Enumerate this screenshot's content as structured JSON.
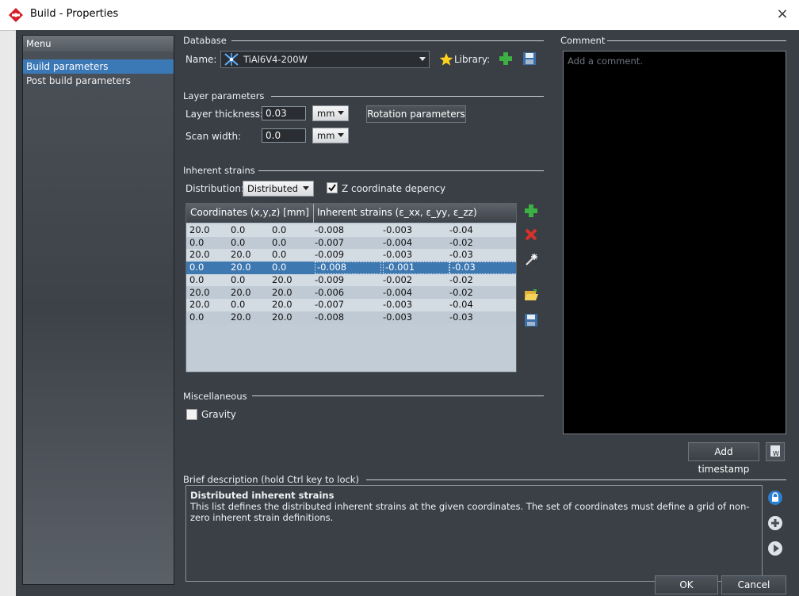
{
  "window": {
    "title": "Build - Properties",
    "close": "×"
  },
  "menu": {
    "header": "Menu",
    "items": [
      {
        "label": "Build parameters",
        "selected": true
      },
      {
        "label": "Post build parameters",
        "selected": false
      }
    ]
  },
  "database": {
    "section": "Database",
    "name_label": "Name:",
    "name_value": "TiAl6V4-200W",
    "library_label": "Library:"
  },
  "layer": {
    "section": "Layer parameters",
    "thickness_label": "Layer thickness:",
    "thickness_value": "0.03",
    "thickness_unit": "mm",
    "scan_label": "Scan width:",
    "scan_value": "0.0",
    "scan_unit": "mm",
    "rotation_button": "Rotation parameters"
  },
  "strains": {
    "section": "Inherent strains",
    "distribution_label": "Distribution:",
    "distribution_value": "Distributed",
    "z_checkbox_label": "Z coordinate depency",
    "z_checked": true,
    "col_coords": "Coordinates (x,y,z) [mm]",
    "col_strains": "Inherent strains (ε_xx, ε_yy, ε_zz)",
    "rows": [
      [
        "20.0",
        "0.0",
        "0.0",
        "-0.008",
        "-0.003",
        "-0.04"
      ],
      [
        "0.0",
        "0.0",
        "0.0",
        "-0.007",
        "-0.004",
        "-0.02"
      ],
      [
        "20.0",
        "20.0",
        "0.0",
        "-0.009",
        "-0.003",
        "-0.03"
      ],
      [
        "0.0",
        "20.0",
        "0.0",
        "-0.008",
        "-0.001",
        "-0.03"
      ],
      [
        "0.0",
        "0.0",
        "20.0",
        "-0.009",
        "-0.002",
        "-0.02"
      ],
      [
        "20.0",
        "20.0",
        "20.0",
        "-0.006",
        "-0.004",
        "-0.02"
      ],
      [
        "20.0",
        "0.0",
        "20.0",
        "-0.007",
        "-0.003",
        "-0.04"
      ],
      [
        "0.0",
        "20.0",
        "20.0",
        "-0.008",
        "-0.003",
        "-0.03"
      ]
    ],
    "selected_row": 3
  },
  "misc": {
    "section": "Miscellaneous",
    "gravity_label": "Gravity",
    "gravity_checked": false
  },
  "comment": {
    "section": "Comment",
    "placeholder": "Add a comment.",
    "timestamp_button": "Add timestamp"
  },
  "description": {
    "section": "Brief description (hold Ctrl key to lock)",
    "title": "Distributed inherent strains",
    "body": "This list defines the distributed inherent strains at the given coordinates. The set of coordinates must define a grid of non-zero inherent strain definitions."
  },
  "footer": {
    "ok": "OK",
    "cancel": "Cancel"
  },
  "colors": {
    "accent": "#3b78b6",
    "add_green": "#3cb043",
    "delete_red": "#d8322a",
    "brand_red": "#d4202a"
  },
  "icons": {
    "app": "build-logo-icon",
    "material": "material-crystal-icon",
    "star": "star-icon",
    "add": "plus-icon",
    "delete": "x-icon",
    "wand": "magic-wand-icon",
    "open": "folder-open-icon",
    "save": "floppy-icon"
  }
}
